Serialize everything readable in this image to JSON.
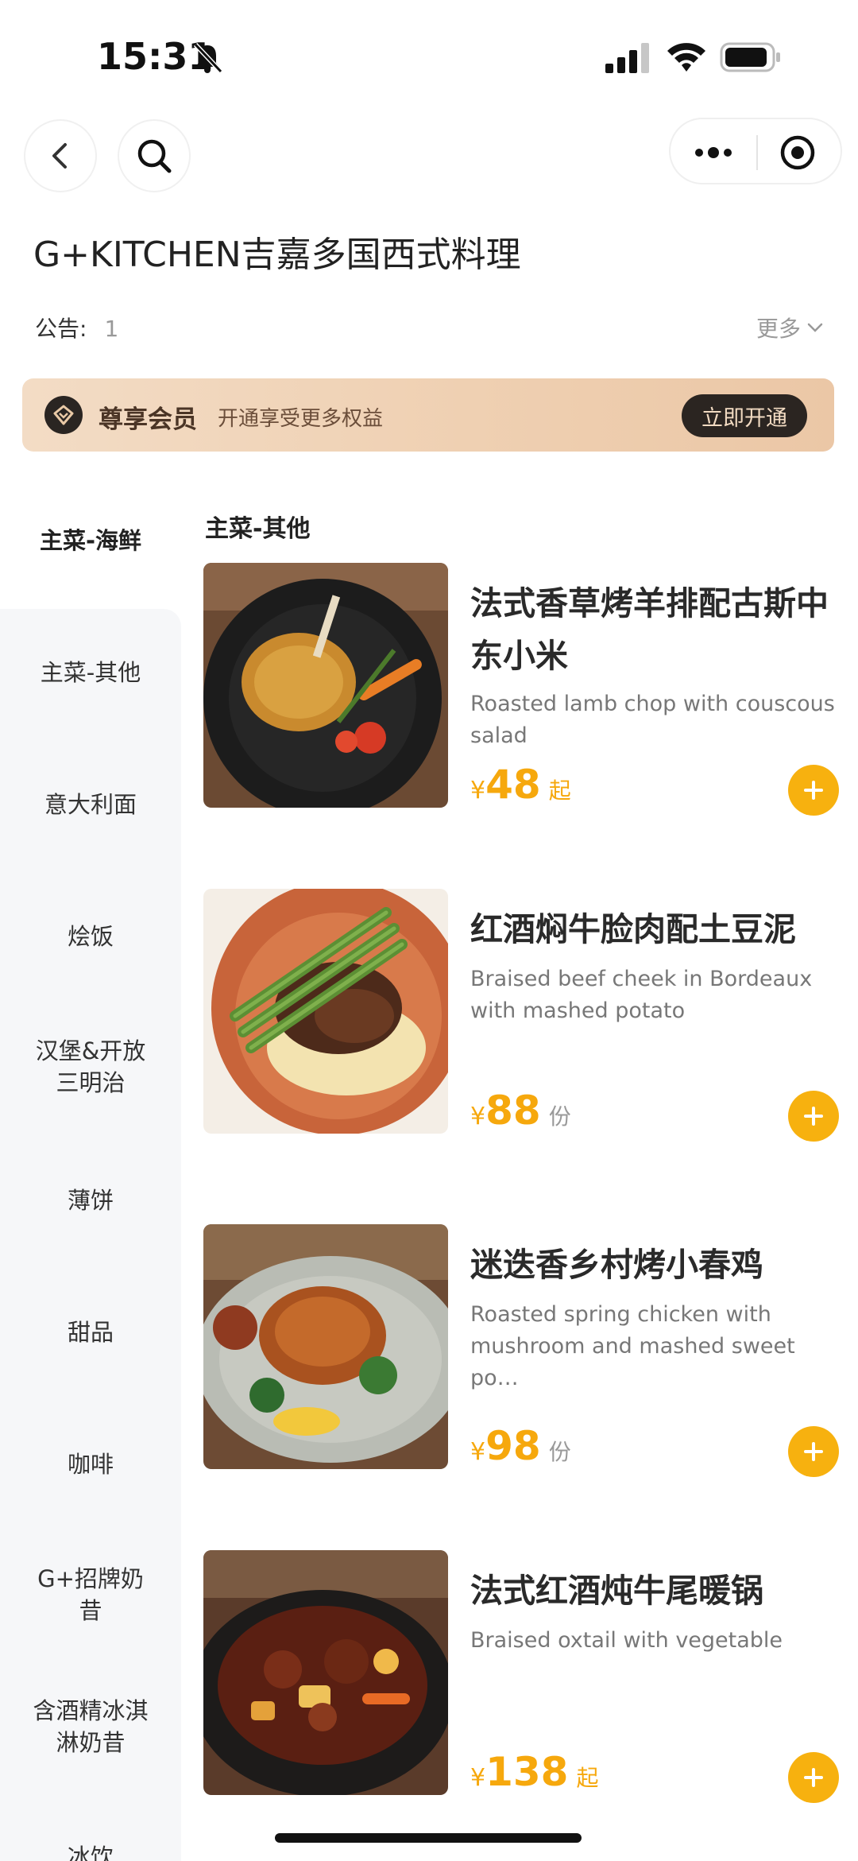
{
  "status_bar": {
    "time": "15:31"
  },
  "store": {
    "title": "G+KITCHEN吉嘉多国西式料理",
    "notice_label": "公告:",
    "notice_value": "1",
    "more_label": "更多"
  },
  "member": {
    "title": "尊享会员",
    "subtitle": "开通享受更多权益",
    "button": "立即开通"
  },
  "sidebar": {
    "items": [
      {
        "label": "主菜-海鲜"
      },
      {
        "label": "主菜-其他"
      },
      {
        "label": "意大利面"
      },
      {
        "label": "烩饭"
      },
      {
        "label": "汉堡&开放\n三明治"
      },
      {
        "label": "薄饼"
      },
      {
        "label": "甜品"
      },
      {
        "label": "咖啡"
      },
      {
        "label": "G+招牌奶\n昔"
      },
      {
        "label": "含酒精冰淇\n淋奶昔"
      },
      {
        "label": "冰饮"
      }
    ]
  },
  "section": {
    "title": "主菜-其他"
  },
  "dishes": [
    {
      "name": "法式香草烤羊排配古斯中东小米",
      "desc": "Roasted lamb chop with couscous salad",
      "currency": "¥",
      "price": "48",
      "unit": "起"
    },
    {
      "name": "红酒焖牛脸肉配土豆泥",
      "desc": "Braised beef cheek in Bordeaux with mashed potato",
      "currency": "¥",
      "price": "88",
      "unit": "份"
    },
    {
      "name": "迷迭香乡村烤小春鸡",
      "desc": "Roasted spring chicken with mushroom and mashed sweet po…",
      "currency": "¥",
      "price": "98",
      "unit": "份"
    },
    {
      "name": "法式红酒炖牛尾暖锅",
      "desc": "Braised oxtail with vegetable",
      "currency": "¥",
      "price": "138",
      "unit": "起"
    }
  ],
  "colors": {
    "accent": "#f7b10f",
    "price": "#f6a80d",
    "member_bg": "#efd0b2"
  }
}
